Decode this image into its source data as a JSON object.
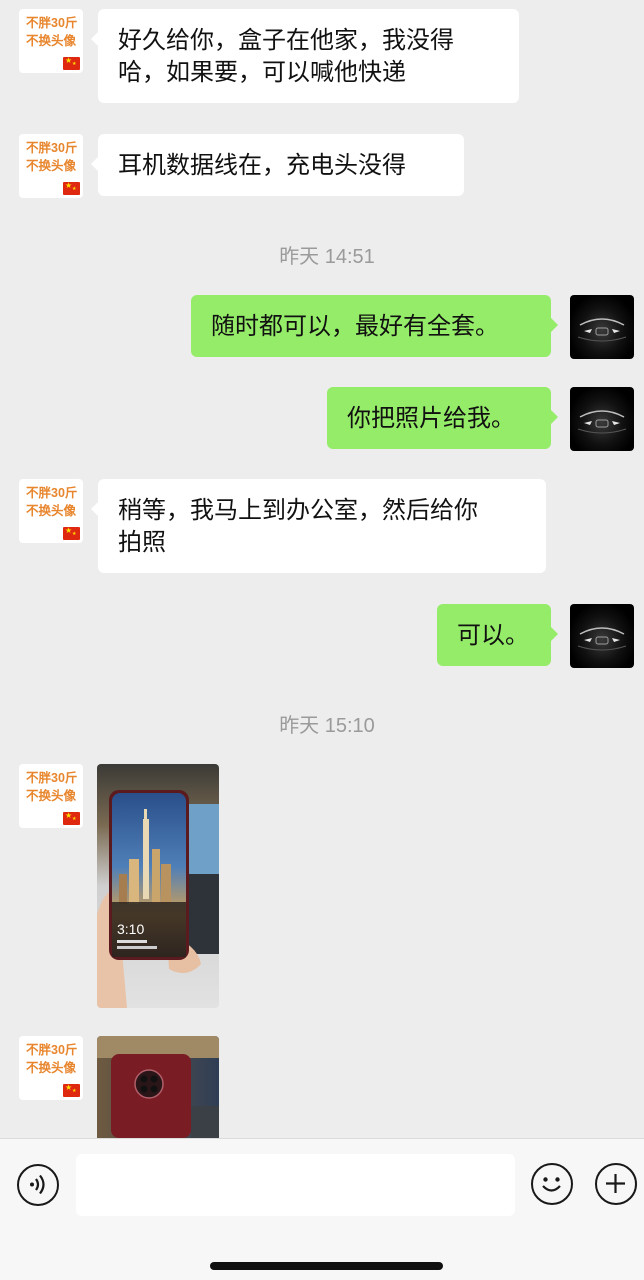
{
  "contact_avatar": {
    "line1": "不胖30斤",
    "line2": "不换头像",
    "flag": "china-flag-icon"
  },
  "my_avatar": {
    "icon": "car-headlights-icon"
  },
  "messages": [
    {
      "side": "in",
      "lines": [
        "好久给你，盒子在他家，我没得",
        "哈，如果要，可以喊他快递"
      ]
    },
    {
      "side": "in",
      "lines": [
        "耳机数据线在，充电头没得"
      ]
    },
    {
      "side": "out",
      "lines": [
        "随时都可以，最好有全套。"
      ]
    },
    {
      "side": "out",
      "lines": [
        "你把照片给我。"
      ]
    },
    {
      "side": "in",
      "lines": [
        "稍等，我马上到办公室，然后给你",
        "拍照"
      ]
    },
    {
      "side": "out",
      "lines": [
        "可以。"
      ]
    }
  ],
  "timestamps": [
    "昨天 14:51",
    "昨天 15:10"
  ],
  "photos": [
    {
      "lock_time": "3:10",
      "content": "phone-front-lockscreen-photo"
    },
    {
      "content": "phone-back-camera-photo"
    }
  ],
  "input_bar": {
    "voice_icon": "voice-icon",
    "emoji_icon": "emoji-icon",
    "plus_icon": "plus-icon",
    "placeholder": ""
  },
  "colors": {
    "background": "#ededed",
    "incoming_bubble": "#ffffff",
    "outgoing_bubble": "#95ec69",
    "timestamp_text": "#9a9a9a",
    "avatar_text": "#e8862e",
    "flag_red": "#de2910",
    "bottom_bar": "#f7f7f7"
  }
}
